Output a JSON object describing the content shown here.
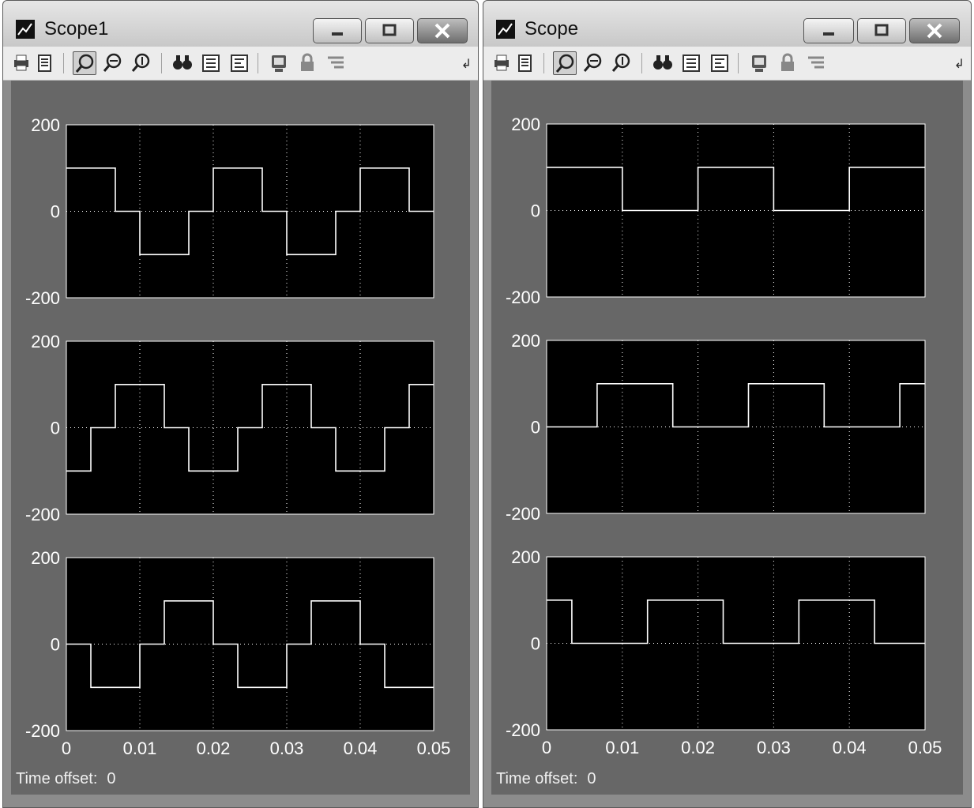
{
  "windows": [
    {
      "title": "Scope1",
      "time_offset_label": "Time offset:",
      "time_offset_value": "0"
    },
    {
      "title": "Scope",
      "time_offset_label": "Time offset:",
      "time_offset_value": "0"
    }
  ],
  "toolbar_icons": [
    "print-icon",
    "parameters-icon",
    "zoom-icon",
    "zoom-x-icon",
    "zoom-y-icon",
    "autoscale-icon",
    "save-axes-icon",
    "restore-axes-icon",
    "floating-scope-icon",
    "lock-icon",
    "signal-selection-icon"
  ],
  "colors": {
    "plot_bg": "#000000",
    "trace": "#ffffff",
    "figure_bg": "#676767"
  },
  "chart_data": [
    {
      "type": "line",
      "window": "Scope1",
      "plot": 1,
      "ylim": [
        -200,
        200
      ],
      "yticks": [
        "200",
        "0",
        "-200"
      ],
      "x": [
        0,
        0.00667,
        0.00667,
        0.01,
        0.01,
        0.01667,
        0.01667,
        0.02,
        0.02,
        0.02667,
        0.02667,
        0.03,
        0.03,
        0.03667,
        0.03667,
        0.04,
        0.04,
        0.04667,
        0.04667,
        0.05
      ],
      "y": [
        100,
        100,
        0,
        0,
        -100,
        -100,
        0,
        0,
        100,
        100,
        0,
        0,
        -100,
        -100,
        0,
        0,
        100,
        100,
        0,
        0
      ],
      "xlim": [
        0,
        0.05
      ],
      "grid": true
    },
    {
      "type": "line",
      "window": "Scope1",
      "plot": 2,
      "ylim": [
        -200,
        200
      ],
      "yticks": [
        "200",
        "0",
        "-200"
      ],
      "x": [
        0,
        0.00333,
        0.00333,
        0.00667,
        0.00667,
        0.01333,
        0.01333,
        0.01667,
        0.01667,
        0.02333,
        0.02333,
        0.02667,
        0.02667,
        0.03333,
        0.03333,
        0.03667,
        0.03667,
        0.04333,
        0.04333,
        0.04667,
        0.04667,
        0.05
      ],
      "y": [
        -100,
        -100,
        0,
        0,
        100,
        100,
        0,
        0,
        -100,
        -100,
        0,
        0,
        100,
        100,
        0,
        0,
        -100,
        -100,
        0,
        0,
        100,
        100
      ],
      "xlim": [
        0,
        0.05
      ],
      "grid": true
    },
    {
      "type": "line",
      "window": "Scope1",
      "plot": 3,
      "ylim": [
        -200,
        200
      ],
      "yticks": [
        "200",
        "0",
        "-200"
      ],
      "xticks": [
        "0",
        "0.01",
        "0.02",
        "0.03",
        "0.04",
        "0.05"
      ],
      "x": [
        0,
        0.00333,
        0.00333,
        0.01,
        0.01,
        0.01333,
        0.01333,
        0.02,
        0.02,
        0.02333,
        0.02333,
        0.03,
        0.03,
        0.03333,
        0.03333,
        0.04,
        0.04,
        0.04333,
        0.04333,
        0.05
      ],
      "y": [
        0,
        0,
        -100,
        -100,
        0,
        0,
        100,
        100,
        0,
        0,
        -100,
        -100,
        0,
        0,
        100,
        100,
        0,
        0,
        -100,
        -100
      ],
      "xlim": [
        0,
        0.05
      ],
      "grid": true
    },
    {
      "type": "line",
      "window": "Scope",
      "plot": 1,
      "ylim": [
        -200,
        200
      ],
      "yticks": [
        "200",
        "0",
        "-200"
      ],
      "x": [
        0,
        0.01,
        0.01,
        0.02,
        0.02,
        0.03,
        0.03,
        0.04,
        0.04,
        0.05
      ],
      "y": [
        100,
        100,
        0,
        0,
        100,
        100,
        0,
        0,
        100,
        100
      ],
      "xlim": [
        0,
        0.05
      ],
      "grid": true
    },
    {
      "type": "line",
      "window": "Scope",
      "plot": 2,
      "ylim": [
        -200,
        200
      ],
      "yticks": [
        "200",
        "0",
        "-200"
      ],
      "x": [
        0,
        0.00667,
        0.00667,
        0.01667,
        0.01667,
        0.02667,
        0.02667,
        0.03667,
        0.03667,
        0.04667,
        0.04667,
        0.05
      ],
      "y": [
        0,
        0,
        100,
        100,
        0,
        0,
        100,
        100,
        0,
        0,
        100,
        100
      ],
      "xlim": [
        0,
        0.05
      ],
      "grid": true
    },
    {
      "type": "line",
      "window": "Scope",
      "plot": 3,
      "ylim": [
        -200,
        200
      ],
      "yticks": [
        "200",
        "0",
        "-200"
      ],
      "xticks": [
        "0",
        "0.01",
        "0.02",
        "0.03",
        "0.04",
        "0.05"
      ],
      "x": [
        0,
        0.00333,
        0.00333,
        0.01333,
        0.01333,
        0.02333,
        0.02333,
        0.03333,
        0.03333,
        0.04333,
        0.04333,
        0.05
      ],
      "y": [
        100,
        100,
        0,
        0,
        100,
        100,
        0,
        0,
        100,
        100,
        0,
        0
      ],
      "xlim": [
        0,
        0.05
      ],
      "grid": true
    }
  ]
}
